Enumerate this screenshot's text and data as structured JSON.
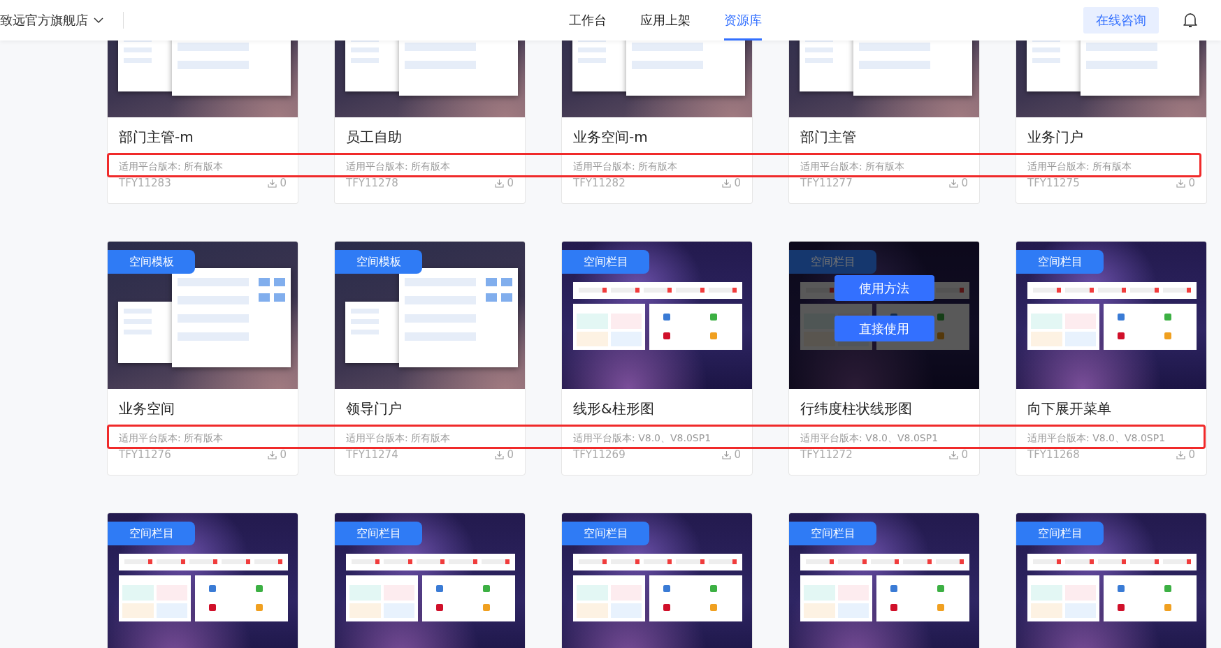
{
  "header": {
    "store": "致远官方旗舰店",
    "nav": [
      {
        "label": "工作台",
        "selected": false
      },
      {
        "label": "应用上架",
        "selected": false
      },
      {
        "label": "资源库",
        "selected": true
      }
    ],
    "consult_button": "在线咨询"
  },
  "rows": [
    {
      "highlighted": true,
      "cards": [
        {
          "kind": "layout",
          "hovered": false,
          "title": "部门主管-m",
          "version": "适用平台版本: 所有版本",
          "code": "TFY11283",
          "downloads": "0"
        },
        {
          "kind": "layout",
          "hovered": false,
          "title": "员工自助",
          "version": "适用平台版本: 所有版本",
          "code": "TFY11278",
          "downloads": "0"
        },
        {
          "kind": "layout",
          "hovered": false,
          "title": "业务空间-m",
          "version": "适用平台版本: 所有版本",
          "code": "TFY11282",
          "downloads": "0"
        },
        {
          "kind": "layout",
          "hovered": false,
          "title": "部门主管",
          "version": "适用平台版本: 所有版本",
          "code": "TFY11277",
          "downloads": "0"
        },
        {
          "kind": "layout",
          "hovered": false,
          "title": "业务门户",
          "version": "适用平台版本: 所有版本",
          "code": "TFY11275",
          "downloads": "0"
        }
      ]
    },
    {
      "highlighted": true,
      "cards": [
        {
          "kind": "layout",
          "badge": "空间模板",
          "hovered": false,
          "title": "业务空间",
          "version": "适用平台版本: 所有版本",
          "code": "TFY11276",
          "downloads": "0"
        },
        {
          "kind": "layout",
          "badge": "空间模板",
          "hovered": false,
          "title": "领导门户",
          "version": "适用平台版本: 所有版本",
          "code": "TFY11274",
          "downloads": "0"
        },
        {
          "kind": "dashboard",
          "badge": "空间栏目",
          "hovered": false,
          "title": "线形&柱形图",
          "version": "适用平台版本: V8.0、V8.0SP1",
          "code": "TFY11269",
          "downloads": "0"
        },
        {
          "kind": "dashboard",
          "badge": "空间栏目",
          "hovered": true,
          "actions": [
            "使用方法",
            "直接使用"
          ],
          "title": "行纬度柱状线形图",
          "version": "适用平台版本: V8.0、V8.0SP1",
          "code": "TFY11272",
          "downloads": "0"
        },
        {
          "kind": "dashboard",
          "badge": "空间栏目",
          "hovered": false,
          "title": "向下展开菜单",
          "version": "适用平台版本: V8.0、V8.0SP1",
          "code": "TFY11268",
          "downloads": "0"
        }
      ]
    },
    {
      "highlighted": false,
      "cards": [
        {
          "kind": "dashboard",
          "badge": "空间栏目",
          "hovered": false
        },
        {
          "kind": "dashboard",
          "badge": "空间栏目",
          "hovered": false
        },
        {
          "kind": "dashboard",
          "badge": "空间栏目",
          "hovered": false
        },
        {
          "kind": "dashboard",
          "badge": "空间栏目",
          "hovered": false
        },
        {
          "kind": "dashboard",
          "badge": "空间栏目",
          "hovered": false
        }
      ]
    }
  ]
}
